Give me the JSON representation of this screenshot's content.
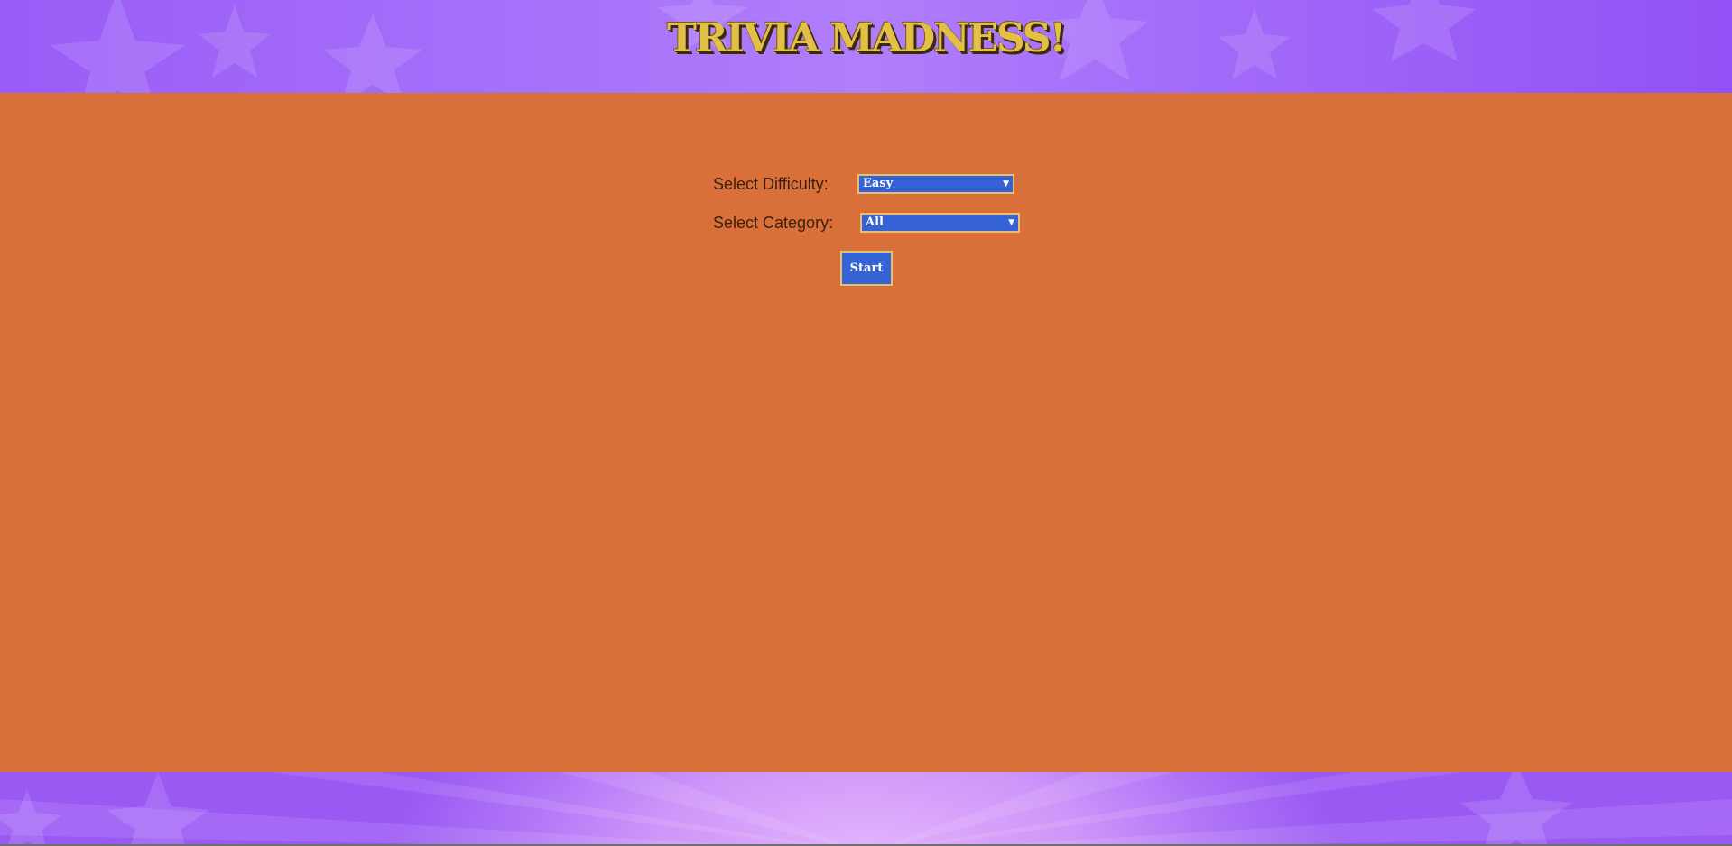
{
  "header": {
    "title": "TRIVIA MADNESS!"
  },
  "form": {
    "difficulty": {
      "label": "Select Difficulty:",
      "selected": "Easy"
    },
    "category": {
      "label": "Select Category:",
      "selected": "All"
    },
    "start_label": "Start"
  },
  "colors": {
    "background": "#d97039",
    "header_purple": "#a670fa",
    "title_gold": "#e2c046",
    "control_blue": "#3563d6",
    "control_border": "#e5c071"
  },
  "icons": {
    "dropdown_arrow": "chevron-down-icon",
    "header_decor": "star-icon",
    "footer_decor": "star-icon"
  }
}
